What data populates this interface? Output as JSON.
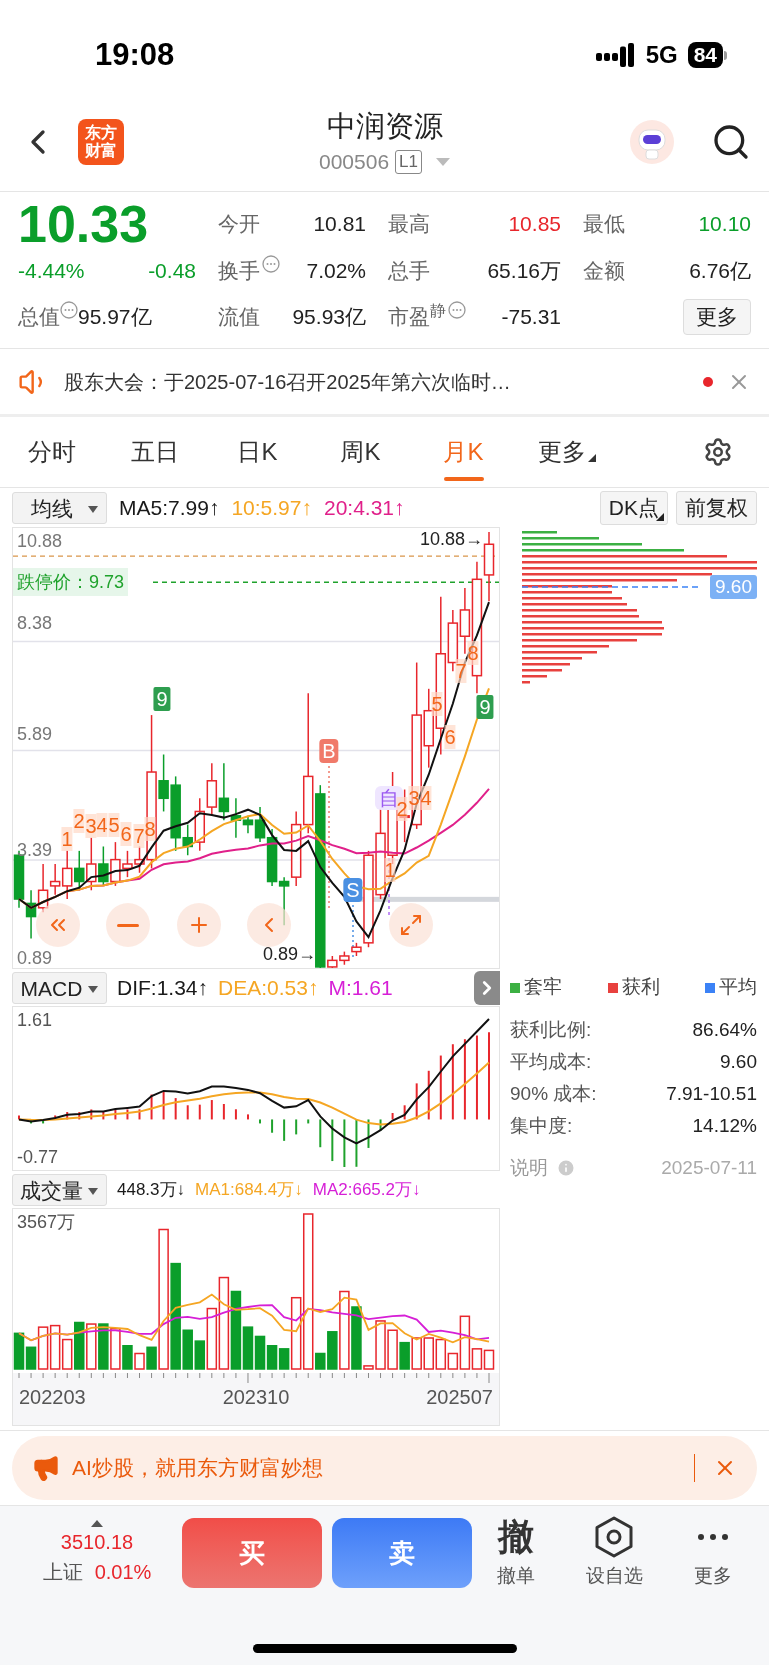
{
  "status_bar": {
    "time": "19:08",
    "network": "5G",
    "battery": "84"
  },
  "header": {
    "logo": [
      "东方",
      "财富"
    ],
    "title": "中润资源",
    "code": "000506",
    "badge": "L1"
  },
  "quote": {
    "price": "10.33",
    "change_pct": "-4.44%",
    "change": "-0.48",
    "color": "#0a9e2a",
    "market_cap": {
      "label": "总值",
      "value": "95.97亿",
      "info": true
    },
    "stats": [
      {
        "label": "今开",
        "value": "10.81",
        "color": "#222222",
        "info": false
      },
      {
        "label": "最高",
        "value": "10.85",
        "color": "#e8262c",
        "info": false
      },
      {
        "label": "最低",
        "value": "10.10",
        "color": "#0a9e2a",
        "info": false
      },
      {
        "label": "换手",
        "value": "7.02%",
        "color": "#222222",
        "info": true
      },
      {
        "label": "总手",
        "value": "65.16万",
        "color": "#222222",
        "info": false
      },
      {
        "label": "金额",
        "value": "6.76亿",
        "color": "#222222",
        "info": false
      },
      {
        "label": "流值",
        "value": "95.93亿",
        "color": "#222222",
        "info": false
      },
      {
        "label": "市盈$^{静}$",
        "value": "-75.31",
        "color": "#222222",
        "info": true
      }
    ],
    "more_button": "更多"
  },
  "notice": {
    "text": "股东大会：于2025-07-16召开2025年第六次临时…",
    "unread": true
  },
  "tabs": [
    {
      "label": "分时",
      "selected": false,
      "dropdown": false
    },
    {
      "label": "五日",
      "selected": false,
      "dropdown": false
    },
    {
      "label": "日K",
      "selected": false,
      "dropdown": false
    },
    {
      "label": "周K",
      "selected": false,
      "dropdown": false
    },
    {
      "label": "月K",
      "selected": true,
      "dropdown": false
    },
    {
      "label": "更多",
      "selected": false,
      "dropdown": true
    }
  ],
  "chart_toolbar": {
    "indicator": "均线",
    "values": [
      {
        "text": "MA5:7.99↑",
        "color": "#1a1a1a"
      },
      {
        "text": "10:5.97↑",
        "color": "#f5a623"
      },
      {
        "text": "20:4.31↑",
        "color": "#e0208a"
      }
    ],
    "buttons": [
      "DK点",
      "前复权"
    ]
  },
  "price_chart": {
    "y_labels": [
      "10.88",
      "8.38",
      "5.89",
      "3.39",
      "0.89"
    ],
    "high_label": "10.88→",
    "low_label": "0.89→",
    "limit_label": "跌停价：9.73",
    "markers": [
      {
        "kind": "nine",
        "text": "9"
      },
      {
        "kind": "count",
        "text": "1"
      },
      {
        "kind": "count",
        "text": "2"
      },
      {
        "kind": "count",
        "text": "3"
      },
      {
        "kind": "count",
        "text": "4"
      },
      {
        "kind": "count",
        "text": "5"
      },
      {
        "kind": "count",
        "text": "6"
      },
      {
        "kind": "count",
        "text": "7"
      },
      {
        "kind": "count",
        "text": "8"
      },
      {
        "kind": "buy",
        "text": "B"
      },
      {
        "kind": "sell",
        "text": "S"
      },
      {
        "kind": "self",
        "text": "自"
      },
      {
        "kind": "count",
        "text": "1"
      },
      {
        "kind": "count",
        "text": "2"
      },
      {
        "kind": "count",
        "text": "3"
      },
      {
        "kind": "count",
        "text": "4"
      },
      {
        "kind": "count",
        "text": "5"
      },
      {
        "kind": "count",
        "text": "6"
      },
      {
        "kind": "count",
        "text": "7"
      },
      {
        "kind": "count",
        "text": "8"
      },
      {
        "kind": "nine",
        "text": "9"
      }
    ]
  },
  "chip_panel": {
    "average_cost": "9.60",
    "legend": [
      {
        "label": "套牢",
        "color": "#3cb043"
      },
      {
        "label": "获利",
        "color": "#e8413e"
      },
      {
        "label": "平均",
        "color": "#3b82f6"
      }
    ],
    "rows": [
      {
        "label": "获利比例:",
        "value": "86.64%"
      },
      {
        "label": "平均成本:",
        "value": "9.60"
      },
      {
        "label": "90% 成本:",
        "value": "7.91-10.51"
      },
      {
        "label": "集中度:",
        "value": "14.12%"
      }
    ],
    "footer": "说明",
    "date": "2025-07-11"
  },
  "macd": {
    "indicator": "MACD",
    "values": [
      {
        "text": "DIF:1.34↑",
        "color": "#1a1a1a"
      },
      {
        "text": "DEA:0.53↑",
        "color": "#f5a623"
      },
      {
        "text": "M:1.61",
        "color": "#d61fd6"
      }
    ],
    "y_labels": [
      "1.61",
      "-0.77"
    ]
  },
  "volume": {
    "indicator": "成交量",
    "values": [
      {
        "text": "448.3万↓",
        "color": "#1a1a1a"
      },
      {
        "text": "MA1:684.4万↓",
        "color": "#f5a623"
      },
      {
        "text": "MA2:665.2万↓",
        "color": "#d61fd6"
      }
    ],
    "y_label": "3567万",
    "x_labels": [
      "202203",
      "202310",
      "202507"
    ]
  },
  "banner": {
    "text": "AI炒股，就用东方财富妙想"
  },
  "bottom_bar": {
    "index": {
      "value": "3510.18",
      "name": "上证",
      "change": "0.01%",
      "color": "#e8262c"
    },
    "buy": "买",
    "sell": "卖",
    "actions": [
      {
        "kind": "glyph",
        "glyph": "撤",
        "label": "撤单"
      },
      {
        "kind": "hexagon",
        "label": "设自选"
      },
      {
        "kind": "dots",
        "label": "更多"
      }
    ]
  }
}
